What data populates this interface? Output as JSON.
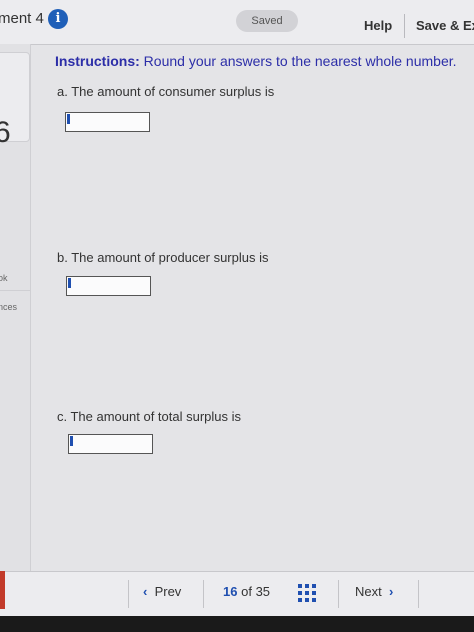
{
  "header": {
    "title": "ment 4",
    "info_icon": "i",
    "saved": "Saved",
    "help": "Help",
    "save_exit": "Save & Exi"
  },
  "rail": {
    "number": "6",
    "ebook": "ok",
    "references": "nces"
  },
  "main": {
    "instructions_label": "Instructions:",
    "instructions_text": " Round your answers to the nearest whole number.",
    "questions": [
      {
        "label": "a. The amount of consumer surplus is",
        "value": ""
      },
      {
        "label": "b. The amount of producer surplus is",
        "value": ""
      },
      {
        "label": "c. The amount of total surplus is",
        "value": ""
      }
    ]
  },
  "nav": {
    "prev_chevron": "‹",
    "prev": "Prev",
    "current_page": "16",
    "of": "of",
    "total_pages": "35",
    "next": "Next",
    "next_chevron": "›"
  },
  "colors": {
    "accent": "#1f4fb0",
    "instructions": "#2c2ea8",
    "info_icon": "#1f5fb8"
  }
}
